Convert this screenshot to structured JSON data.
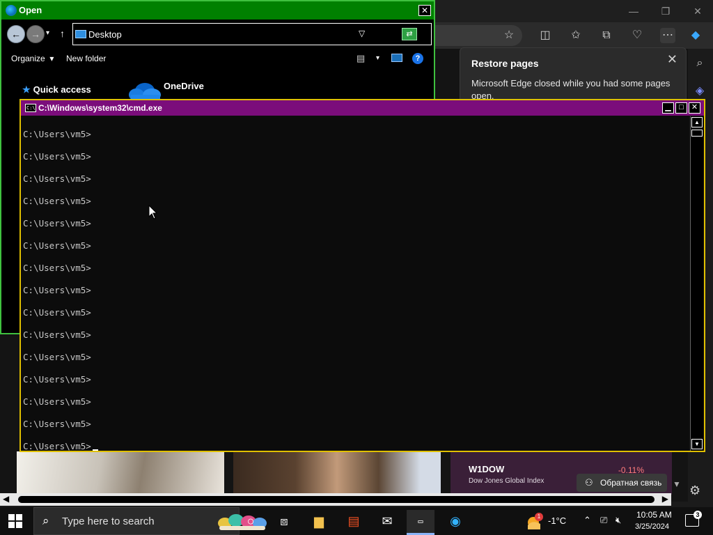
{
  "edge": {
    "restore_title": "Restore pages",
    "restore_message": "Microsoft Edge closed while you had some pages open.",
    "news_stock_name": "W1DOW",
    "news_stock_index": "Dow Jones Global Index",
    "news_stock_change": "-0.11%",
    "feedback_label": "Обратная связь",
    "colors": {
      "accent": "#0078d4"
    }
  },
  "open_dialog": {
    "title": "Open",
    "address": "Desktop",
    "organize_label": "Organize",
    "organize_arrow": "▾",
    "new_folder_label": "New folder",
    "help_label": "?",
    "quick_access_label": "Quick access",
    "onedrive_label": "OneDrive",
    "colors": {
      "title_bar": "#008000",
      "border": "#3fc13f"
    }
  },
  "cmd": {
    "title": "C:\\Windows\\system32\\cmd.exe",
    "icon_text": "C:\\",
    "minimize": "▁",
    "maximize": "□",
    "close": "✕",
    "lines": [
      "C:\\Users\\vm5>",
      "C:\\Users\\vm5>",
      "C:\\Users\\vm5>",
      "C:\\Users\\vm5>",
      "C:\\Users\\vm5>",
      "C:\\Users\\vm5>",
      "C:\\Users\\vm5>",
      "C:\\Users\\vm5>",
      "C:\\Users\\vm5>",
      "C:\\Users\\vm5>",
      "C:\\Users\\vm5>",
      "C:\\Users\\vm5>",
      "C:\\Users\\vm5>",
      "C:\\Users\\vm5>",
      "C:\\Users\\vm5>"
    ],
    "colors": {
      "title_bar": "#7b0d7b",
      "border": "#e0c000"
    }
  },
  "taskbar": {
    "search_placeholder": "Type here to search",
    "weather_temp": "-1°C",
    "weather_badge": "1",
    "time": "10:05 AM",
    "date": "3/25/2024",
    "notification_count": "3"
  }
}
